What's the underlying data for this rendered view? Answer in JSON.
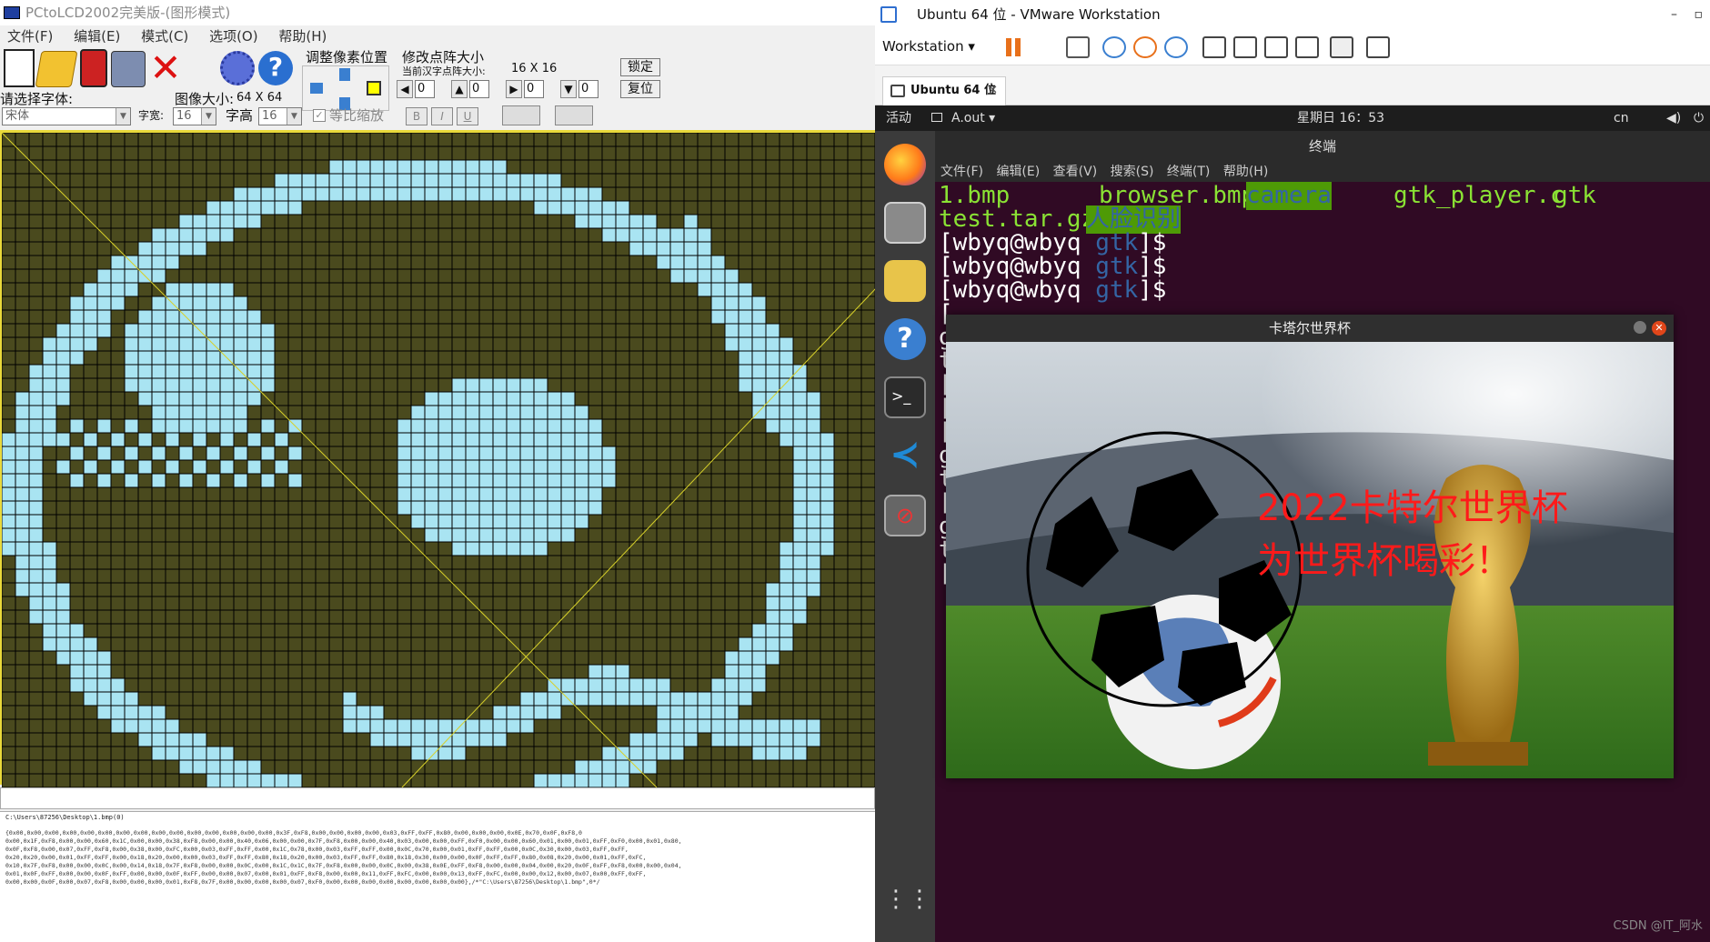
{
  "pc": {
    "title": "PCtoLCD2002完美版-(图形模式)",
    "menu": [
      "文件(F)",
      "编辑(E)",
      "模式(C)",
      "选项(O)",
      "帮助(H)"
    ],
    "labels": {
      "pixel_adjust": "调整像素位置",
      "modify_dot": "修改点阵大小",
      "current_dot": "当前汉字点阵大小:",
      "dot_size": "16 X 16",
      "lock": "锁定",
      "reset": "复位",
      "select_font": "请选择字体:",
      "image_size_label": "图像大小:",
      "image_size_value": "64 X 64",
      "char_width": "字宽:",
      "char_height": "字高",
      "proportional": "等比缩放",
      "bold": "B",
      "italic": "I",
      "underline": "U"
    },
    "font": "宋体",
    "char_width_value": "16",
    "char_height_value": "16",
    "spin_values": [
      "0",
      "0",
      "0",
      "0"
    ],
    "output": {
      "path": "C:\\Users\\87256\\Desktop\\1.bmp(0)",
      "lines": [
        "{0x00,0x00,0x00,0x00,0x00,0x00,0x00,0x00,0x00,0x00,0x00,0x00,0x00,0x00,0x00,0x3F,0xF8,0x00,0x00,0x00,0x00,0x03,0xFF,0xFF,0x80,0x00,0x00,0x00,0x0E,0x70,0x0F,0xF8,0",
        "0x00,0x1F,0xF8,0x00,0x00,0x60,0x1C,0x00,0x00,0x38,0xF8,0x00,0x00,0x40,0x06,0x00,0x00,0x7F,0xF8,0x00,0x00,0x40,0x03,0x00,0x00,0xFF,0xF0,0x00,0x00,0x60,0x01,0x00,0x01,0xFF,0xF0,0x00,0x01,0x80,",
        "0x0F,0xF8,0x00,0x07,0xFF,0xF8,0x00,0x38,0x00,0xFC,0x00,0x03,0xFF,0xFF,0x00,0x1C,0x78,0x00,0x03,0xFF,0xFF,0x00,0x0C,0x70,0x00,0x01,0xFF,0xFF,0x00,0x0C,0x30,0x00,0x03,0xFF,0xFF,",
        "0x20,0x20,0x00,0x01,0xFF,0xFF,0x00,0x18,0x20,0x00,0x00,0x03,0xFF,0xFF,0x80,0x18,0x20,0x00,0x03,0xFF,0xFF,0x80,0x18,0x30,0x00,0x00,0x0F,0xFF,0xFF,0x80,0x08,0x20,0x00,0x01,0xFF,0xFC,",
        "0x10,0x7F,0xF8,0x00,0x00,0x0C,0x00,0x14,0x18,0x7F,0xF8,0x00,0x00,0x0C,0x00,0x1C,0x1C,0x7F,0xF8,0x00,0x00,0x0C,0x00,0x38,0x0E,0xFF,0xF8,0x00,0x00,0x04,0x00,0x20,0x0F,0xFF,0xF8,0x00,0x00,0x04,",
        "0x01,0x0F,0xFF,0x00,0x00,0x0F,0xFF,0x00,0x00,0x0F,0xFF,0x00,0x00,0x07,0x00,0x01,0xFF,0xF8,0x00,0x00,0x11,0xFF,0xFC,0x00,0x00,0x13,0xFF,0xFC,0x00,0x00,0x12,0x00,0x07,0x00,0xFF,0xFF,",
        "0x00,0x00,0x0F,0x00,0x07,0xF8,0x00,0x00,0x00,0x01,0xF8,0x7F,0x00,0x00,0x00,0x00,0x07,0xF0,0x00,0x00,0x00,0x00,0x00,0x00,0x00,0x00},/*\"C:\\Users\\87256\\Desktop\\1.bmp\",0*/"
      ]
    }
  },
  "vm": {
    "title": "Ubuntu 64 位 - VMware Workstation",
    "workstation_label": "Workstation",
    "tab_label": "Ubuntu 64 位",
    "topbar": {
      "activities": "活动",
      "app": "A.out",
      "clock": "星期日 16：53",
      "lang": "cn"
    },
    "terminal": {
      "title": "终端",
      "menu": [
        "文件(F)",
        "编辑(E)",
        "查看(V)",
        "搜索(S)",
        "终端(T)",
        "帮助(H)"
      ],
      "files_row1": [
        "1.bmp",
        "browser.bmp",
        "camera",
        "gtk_player.c",
        "gtk"
      ],
      "files_row2": [
        "test.tar.gz",
        "人脸识别"
      ],
      "prompt": "[wbyq@wbyq ",
      "prompt_dir": "gtk",
      "prompt_end": "]$",
      "partial": [
        "[",
        "g",
        "t",
        "[",
        "[",
        "[",
        "g",
        "t",
        "[",
        "g",
        "t",
        "["
      ]
    },
    "gtk_window": {
      "title": "卡塔尔世界杯",
      "line1": "2022卡特尔世界杯",
      "line2": "为世界杯喝彩！"
    },
    "watermark": "CSDN @IT_阿水"
  },
  "colors": {
    "grid_bg": "#4a4a1e",
    "grid_on": "#a9e4f2",
    "grid_line": "#000000",
    "terminal_bg": "#300a24",
    "file_green": "#8ae234",
    "dir_bg": "#4e9a06",
    "dir_text": "#3465a4",
    "headline_red": "#ff1a1a"
  },
  "icons": [
    "new-file-icon",
    "open-file-icon",
    "save-icon",
    "settings-icon",
    "delete-icon",
    "gear-icon",
    "help-icon",
    "pause-icon",
    "snapshot-icon",
    "fullscreen-icon",
    "terminal-icon",
    "firefox-icon",
    "files-icon",
    "rhythmbox-icon",
    "help-app-icon",
    "vscode-icon",
    "apps-grid-icon"
  ]
}
